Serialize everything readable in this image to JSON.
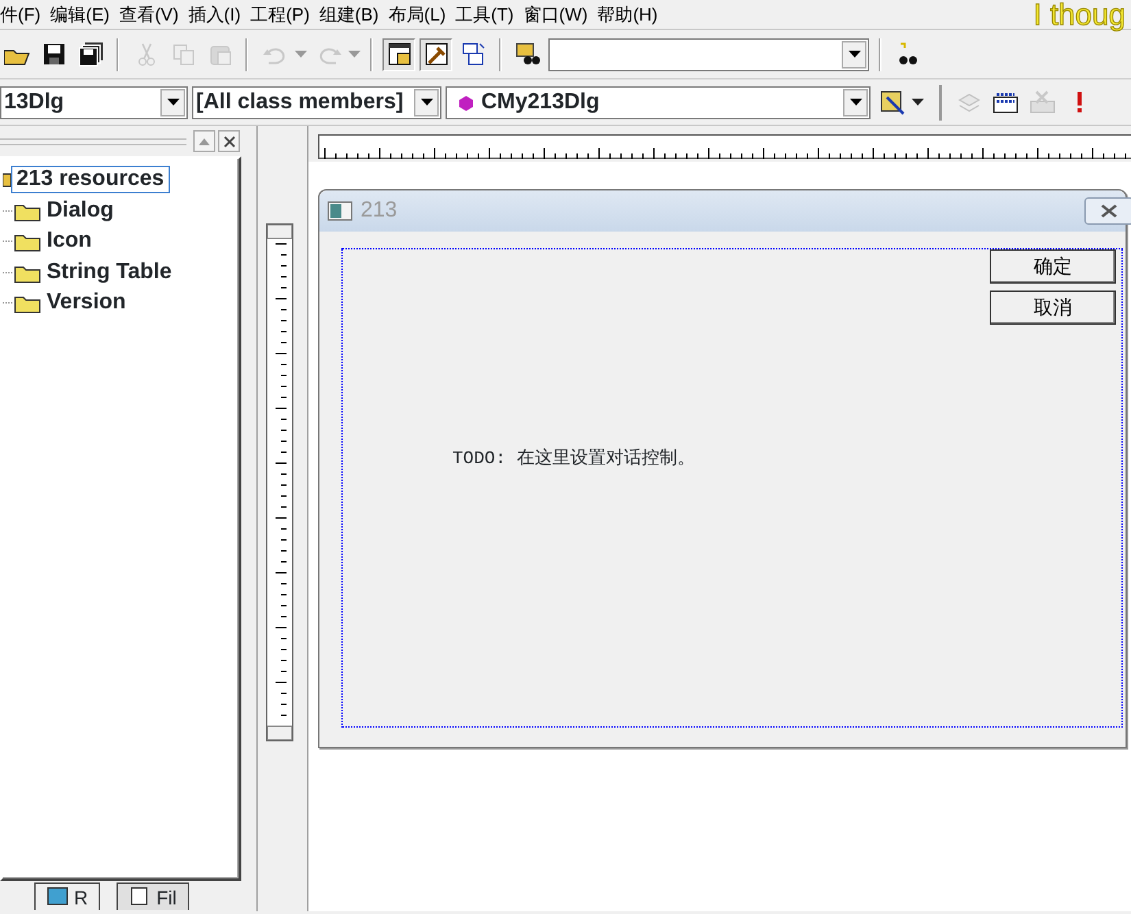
{
  "menu": [
    {
      "label": "件(F)"
    },
    {
      "label": "编辑(E)"
    },
    {
      "label": "查看(V)"
    },
    {
      "label": "插入(I)"
    },
    {
      "label": "工程(P)"
    },
    {
      "label": "组建(B)"
    },
    {
      "label": "布局(L)"
    },
    {
      "label": "工具(T)"
    },
    {
      "label": "窗口(W)"
    },
    {
      "label": "帮助(H)"
    }
  ],
  "banner_text": "I thoug",
  "toolbar": [
    {
      "disabled": false
    },
    {
      "disabled": false
    },
    {
      "disabled": false
    },
    {
      "disabled": true
    },
    {
      "disabled": true
    },
    {
      "disabled": true
    },
    {
      "disabled": true
    },
    {
      "disabled": true
    },
    {
      "disabled": false
    },
    {
      "disabled": false
    },
    {
      "disabled": false
    },
    {
      "disabled": false
    }
  ],
  "wizard_bar": {
    "class_combo": "13Dlg",
    "filter_combo": "[All class members]",
    "member_combo": "CMy213Dlg"
  },
  "tree": {
    "label": "213 resources",
    "selected": true,
    "children": [
      {
        "label": "Dialog",
        "selected": false
      },
      {
        "label": "Icon",
        "selected": false
      },
      {
        "label": "String Table",
        "selected": false
      },
      {
        "label": "Version",
        "selected": false
      }
    ]
  },
  "workspace_tabs": [
    {
      "label": "R",
      "selected": true
    },
    {
      "label": "Fil",
      "selected": false
    }
  ],
  "dialog": {
    "title": "213",
    "buttons": [
      "确定",
      "取消"
    ],
    "static_text": "TODO: 在这里设置对话控制。"
  }
}
